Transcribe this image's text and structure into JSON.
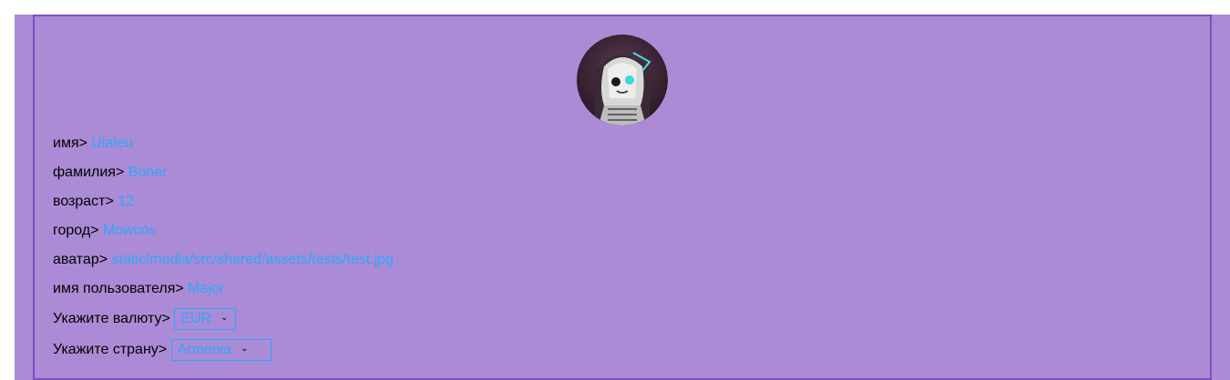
{
  "profile": {
    "avatar_alt": "avatar",
    "fields": [
      {
        "label": "имя> ",
        "value": "Ulaleu"
      },
      {
        "label": "фамилия> ",
        "value": "Boner"
      },
      {
        "label": "возраст> ",
        "value": "12"
      },
      {
        "label": "город> ",
        "value": "Mowcos"
      },
      {
        "label": "аватар> ",
        "value": "static/media/src/shared/assets/tests/test.jpg"
      },
      {
        "label": "имя пользователя> ",
        "value": "Major"
      }
    ],
    "currency": {
      "label": "Укажите валюту> ",
      "selected": "EUR"
    },
    "country": {
      "label": "Укажите страну> ",
      "selected": "Armenia"
    }
  },
  "colors": {
    "background": "#ab8bd6",
    "border": "#7b4fc4",
    "value": "#2aa8ff"
  },
  "icons": {
    "select_chevron": "chevron-down-icon"
  }
}
